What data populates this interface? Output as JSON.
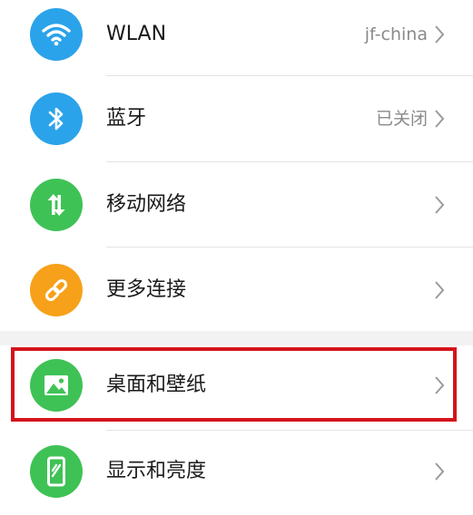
{
  "settings": {
    "items": [
      {
        "label": "WLAN",
        "value": "jf-china",
        "icon": "wifi-icon",
        "color": "#2ba3ea"
      },
      {
        "label": "蓝牙",
        "value": "已关闭",
        "icon": "bluetooth-icon",
        "color": "#2ba3ea"
      },
      {
        "label": "移动网络",
        "value": "",
        "icon": "mobile-data-icon",
        "color": "#3fc255"
      },
      {
        "label": "更多连接",
        "value": "",
        "icon": "link-icon",
        "color": "#f7a11a"
      },
      {
        "label": "桌面和壁纸",
        "value": "",
        "icon": "wallpaper-icon",
        "color": "#3fc255"
      },
      {
        "label": "显示和亮度",
        "value": "",
        "icon": "display-icon",
        "color": "#3fc255"
      }
    ]
  },
  "annotation": {
    "highlight_color": "#d4141c",
    "highlighted_item": "桌面和壁纸"
  }
}
